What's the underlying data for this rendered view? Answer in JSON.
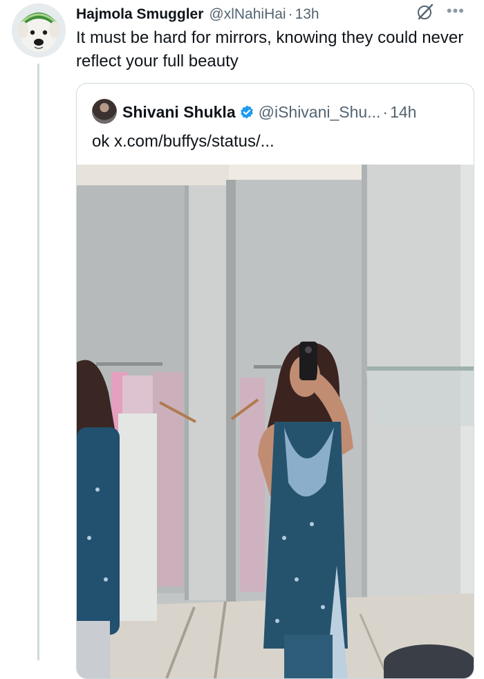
{
  "tweet": {
    "display_name": "Hajmola Smuggler",
    "handle": "@xlNahiHai",
    "separator": "·",
    "time": "13h",
    "text": "It must be hard for mirrors, knowing they could never reflect your full beauty",
    "more_icon": "more-horizontal-icon",
    "grok_icon": "grok-icon"
  },
  "quote": {
    "display_name": "Shivani Shukla",
    "verified_icon": "verified-badge-icon",
    "handle": "@iShivani_Shu...",
    "separator": "·",
    "time": "14h",
    "text": "ok x.com/buffys/status/...",
    "media": "mirror-selfie-photo"
  },
  "colors": {
    "text_primary": "#0f1419",
    "text_secondary": "#536471",
    "border": "#cfd9de",
    "verified": "#1d9bf0"
  }
}
